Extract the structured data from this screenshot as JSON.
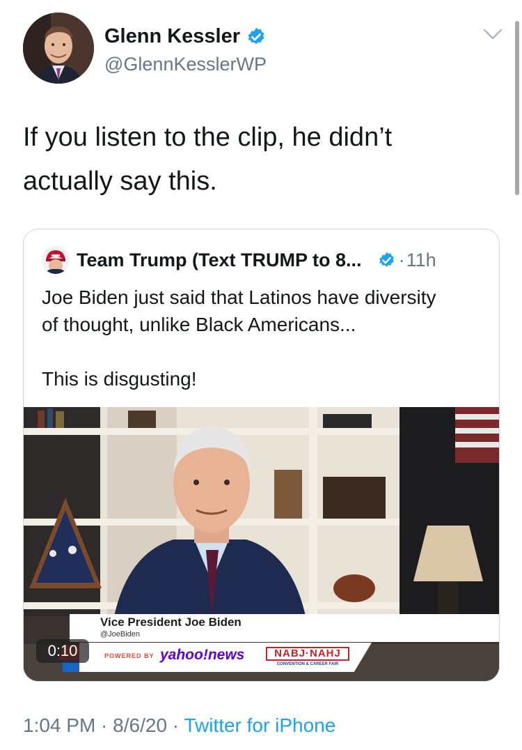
{
  "author": {
    "name": "Glenn Kessler",
    "handle": "@GlennKesslerWP",
    "avatar_icon": "profile-photo"
  },
  "tweet": {
    "text_line1": "If you listen to the clip, he didn’t",
    "text_line2": "actually say this."
  },
  "quoted_tweet": {
    "name": "Team Trump (Text TRUMP to 8...",
    "separator": "·",
    "time": "11h",
    "text_para1_line1": "Joe Biden just said that Latinos have diversity",
    "text_para1_line2": "of thought, unlike Black Americans...",
    "text_para2": "This is disgusting!",
    "video": {
      "caption_name": "Vice President Joe Biden",
      "caption_handle": "@JoeBiden",
      "powered_by": "POWERED BY",
      "brand": "yahoo!news",
      "event_logo": "NABJ·NAHJ",
      "event_sub": "CONVENTION & CAREER FAIR",
      "elapsed": "0:10"
    }
  },
  "footer": {
    "time": "1:04 PM",
    "sep1": " · ",
    "date": "8/6/20",
    "sep2": " · ",
    "source": "Twitter for iPhone"
  },
  "colors": {
    "verified": "#1da1f2",
    "link": "#1da1f2",
    "secondary_text": "#657786",
    "border": "#ccd6dd"
  }
}
